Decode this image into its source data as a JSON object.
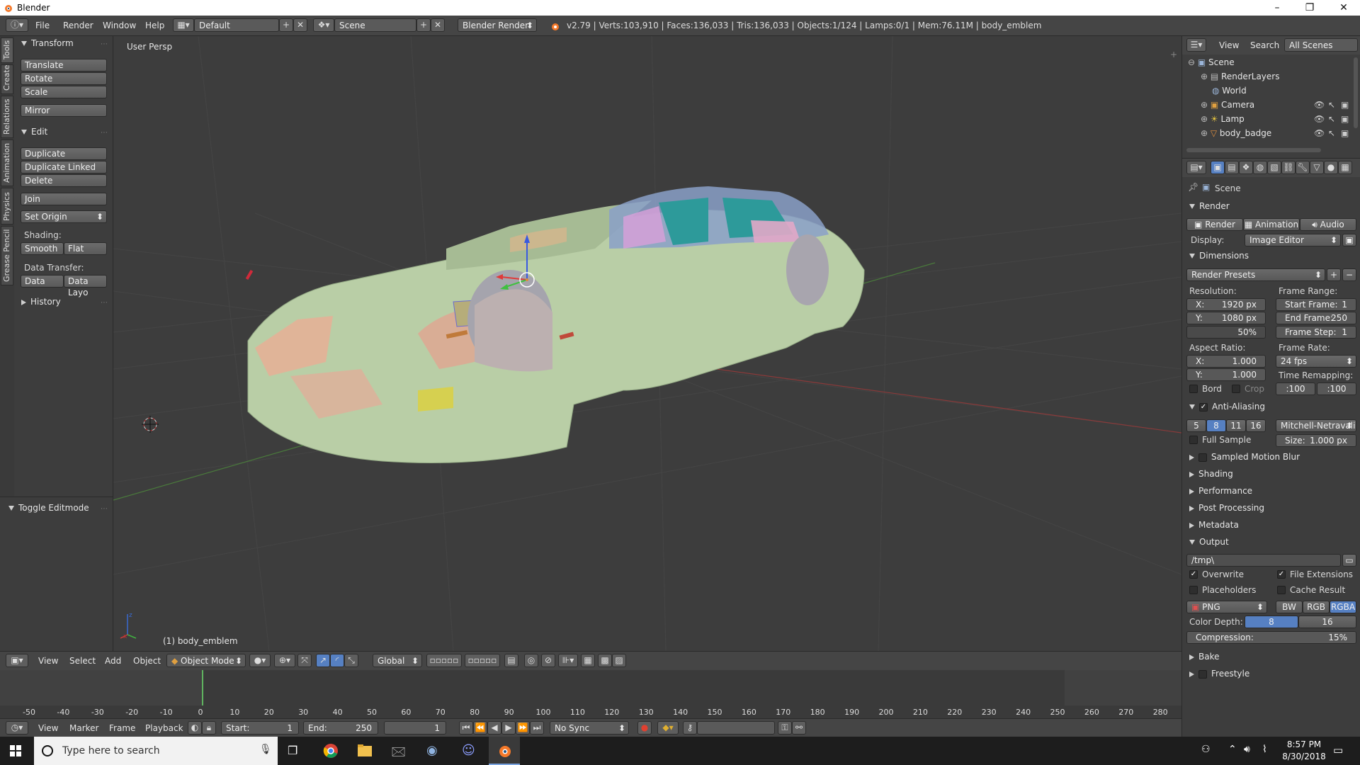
{
  "window": {
    "title": "Blender",
    "minimize": "–",
    "maximize": "❐",
    "close": "✕"
  },
  "info_header": {
    "menus": [
      "File",
      "Render",
      "Window",
      "Help"
    ],
    "layout": "Default",
    "scene": "Scene",
    "engine": "Blender Render",
    "stats": "v2.79 | Verts:103,910 | Faces:136,033 | Tris:136,033 | Objects:1/124 | Lamps:0/1 | Mem:76.11M | body_emblem"
  },
  "tool_tabs": [
    "Tools",
    "Create",
    "Relations",
    "Animation",
    "Physics",
    "Grease Pencil"
  ],
  "toolshelf": {
    "transform_title": "Transform",
    "translate": "Translate",
    "rotate": "Rotate",
    "scale": "Scale",
    "mirror": "Mirror",
    "edit_title": "Edit",
    "duplicate": "Duplicate",
    "duplicate_linked": "Duplicate Linked",
    "delete": "Delete",
    "join": "Join",
    "set_origin": "Set Origin",
    "shading_label": "Shading:",
    "smooth": "Smooth",
    "flat": "Flat",
    "data_transfer_label": "Data Transfer:",
    "data": "Data",
    "data_layo": "Data Layo",
    "history_title": "History",
    "toggle_editmode": "Toggle Editmode"
  },
  "viewport": {
    "view_label": "User Persp",
    "object_label": "(1) body_emblem"
  },
  "view3d_header": {
    "menus": [
      "View",
      "Select",
      "Add",
      "Object"
    ],
    "mode": "Object Mode",
    "orientation": "Global"
  },
  "timeline": {
    "ticks": [
      "-50",
      "-40",
      "-30",
      "-20",
      "-10",
      "0",
      "10",
      "20",
      "30",
      "40",
      "50",
      "60",
      "70",
      "80",
      "90",
      "100",
      "110",
      "120",
      "130",
      "140",
      "150",
      "160",
      "170",
      "180",
      "190",
      "200",
      "210",
      "220",
      "230",
      "240",
      "250",
      "260",
      "270",
      "280"
    ],
    "current_frame_value": 0
  },
  "timeline_header": {
    "menus": [
      "View",
      "Marker",
      "Frame",
      "Playback"
    ],
    "start_label": "Start:",
    "start": "1",
    "end_label": "End:",
    "end": "250",
    "current": "1",
    "sync": "No Sync"
  },
  "outliner": {
    "menus": [
      "View",
      "Search"
    ],
    "filter": "All Scenes",
    "items": [
      "Scene",
      "RenderLayers",
      "World",
      "Camera",
      "Lamp",
      "body_badge"
    ]
  },
  "properties": {
    "context": "Scene",
    "render_title": "Render",
    "render_btn": "Render",
    "animation_btn": "Animation",
    "audio_btn": "Audio",
    "display_label": "Display:",
    "display_value": "Image Editor",
    "dimensions_title": "Dimensions",
    "render_presets": "Render Presets",
    "resolution_label": "Resolution:",
    "res_x_label": "X:",
    "res_x": "1920 px",
    "res_y_label": "Y:",
    "res_y": "1080 px",
    "res_pct": "50%",
    "frame_range_label": "Frame Range:",
    "start_frame_label": "Start Frame:",
    "start_frame": "1",
    "end_frame_label": "End Frame:",
    "end_frame": "250",
    "frame_step_label": "Frame Step:",
    "frame_step": "1",
    "aspect_label": "Aspect Ratio:",
    "asp_x_label": "X:",
    "asp_x": "1.000",
    "asp_y_label": "Y:",
    "asp_y": "1.000",
    "frame_rate_label": "Frame Rate:",
    "frame_rate": "24 fps",
    "time_remap_label": "Time Remapping:",
    "remap_old": ":100",
    "remap_new": ":100",
    "bord": "Bord",
    "crop": "Crop",
    "aa_title": "Anti-Aliasing",
    "aa_samples": [
      "5",
      "8",
      "11",
      "16"
    ],
    "aa_filter": "Mitchell-Netravali",
    "full_sample": "Full Sample",
    "size_label": "Size:",
    "size": "1.000 px",
    "sampled_motion_blur": "Sampled Motion Blur",
    "shading": "Shading",
    "performance": "Performance",
    "post_processing": "Post Processing",
    "metadata": "Metadata",
    "output_title": "Output",
    "output_path": "/tmp\\",
    "overwrite": "Overwrite",
    "file_extensions": "File Extensions",
    "placeholders": "Placeholders",
    "cache_result": "Cache Result",
    "format": "PNG",
    "bw": "BW",
    "rgb": "RGB",
    "rgba": "RGBA",
    "color_depth_label": "Color Depth:",
    "depth_8": "8",
    "depth_16": "16",
    "compression_label": "Compression:",
    "compression": "15%",
    "bake": "Bake",
    "freestyle": "Freestyle"
  },
  "taskbar": {
    "search_placeholder": "Type here to search",
    "time": "8:57 PM",
    "date": "8/30/2018"
  },
  "colors": {
    "accent": "#5680c2",
    "car_body": "#b8cfa4",
    "viewport_bg": "#3d3d3d"
  }
}
